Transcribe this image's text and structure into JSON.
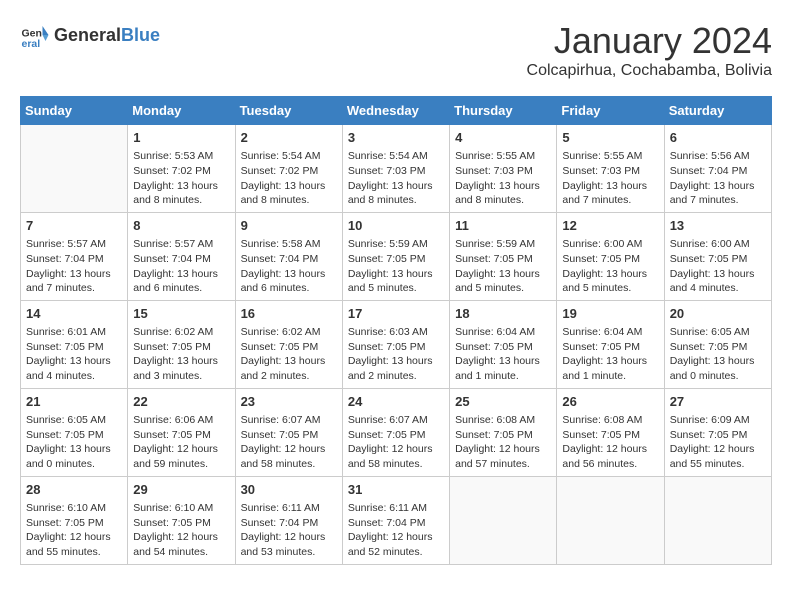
{
  "logo": {
    "general": "General",
    "blue": "Blue"
  },
  "title": "January 2024",
  "subtitle": "Colcapirhua, Cochabamba, Bolivia",
  "days_of_week": [
    "Sunday",
    "Monday",
    "Tuesday",
    "Wednesday",
    "Thursday",
    "Friday",
    "Saturday"
  ],
  "weeks": [
    [
      {
        "day": "",
        "info": ""
      },
      {
        "day": "1",
        "info": "Sunrise: 5:53 AM\nSunset: 7:02 PM\nDaylight: 13 hours\nand 8 minutes."
      },
      {
        "day": "2",
        "info": "Sunrise: 5:54 AM\nSunset: 7:02 PM\nDaylight: 13 hours\nand 8 minutes."
      },
      {
        "day": "3",
        "info": "Sunrise: 5:54 AM\nSunset: 7:03 PM\nDaylight: 13 hours\nand 8 minutes."
      },
      {
        "day": "4",
        "info": "Sunrise: 5:55 AM\nSunset: 7:03 PM\nDaylight: 13 hours\nand 8 minutes."
      },
      {
        "day": "5",
        "info": "Sunrise: 5:55 AM\nSunset: 7:03 PM\nDaylight: 13 hours\nand 7 minutes."
      },
      {
        "day": "6",
        "info": "Sunrise: 5:56 AM\nSunset: 7:04 PM\nDaylight: 13 hours\nand 7 minutes."
      }
    ],
    [
      {
        "day": "7",
        "info": "Sunrise: 5:57 AM\nSunset: 7:04 PM\nDaylight: 13 hours\nand 7 minutes."
      },
      {
        "day": "8",
        "info": "Sunrise: 5:57 AM\nSunset: 7:04 PM\nDaylight: 13 hours\nand 6 minutes."
      },
      {
        "day": "9",
        "info": "Sunrise: 5:58 AM\nSunset: 7:04 PM\nDaylight: 13 hours\nand 6 minutes."
      },
      {
        "day": "10",
        "info": "Sunrise: 5:59 AM\nSunset: 7:05 PM\nDaylight: 13 hours\nand 5 minutes."
      },
      {
        "day": "11",
        "info": "Sunrise: 5:59 AM\nSunset: 7:05 PM\nDaylight: 13 hours\nand 5 minutes."
      },
      {
        "day": "12",
        "info": "Sunrise: 6:00 AM\nSunset: 7:05 PM\nDaylight: 13 hours\nand 5 minutes."
      },
      {
        "day": "13",
        "info": "Sunrise: 6:00 AM\nSunset: 7:05 PM\nDaylight: 13 hours\nand 4 minutes."
      }
    ],
    [
      {
        "day": "14",
        "info": "Sunrise: 6:01 AM\nSunset: 7:05 PM\nDaylight: 13 hours\nand 4 minutes."
      },
      {
        "day": "15",
        "info": "Sunrise: 6:02 AM\nSunset: 7:05 PM\nDaylight: 13 hours\nand 3 minutes."
      },
      {
        "day": "16",
        "info": "Sunrise: 6:02 AM\nSunset: 7:05 PM\nDaylight: 13 hours\nand 2 minutes."
      },
      {
        "day": "17",
        "info": "Sunrise: 6:03 AM\nSunset: 7:05 PM\nDaylight: 13 hours\nand 2 minutes."
      },
      {
        "day": "18",
        "info": "Sunrise: 6:04 AM\nSunset: 7:05 PM\nDaylight: 13 hours\nand 1 minute."
      },
      {
        "day": "19",
        "info": "Sunrise: 6:04 AM\nSunset: 7:05 PM\nDaylight: 13 hours\nand 1 minute."
      },
      {
        "day": "20",
        "info": "Sunrise: 6:05 AM\nSunset: 7:05 PM\nDaylight: 13 hours\nand 0 minutes."
      }
    ],
    [
      {
        "day": "21",
        "info": "Sunrise: 6:05 AM\nSunset: 7:05 PM\nDaylight: 13 hours\nand 0 minutes."
      },
      {
        "day": "22",
        "info": "Sunrise: 6:06 AM\nSunset: 7:05 PM\nDaylight: 12 hours\nand 59 minutes."
      },
      {
        "day": "23",
        "info": "Sunrise: 6:07 AM\nSunset: 7:05 PM\nDaylight: 12 hours\nand 58 minutes."
      },
      {
        "day": "24",
        "info": "Sunrise: 6:07 AM\nSunset: 7:05 PM\nDaylight: 12 hours\nand 58 minutes."
      },
      {
        "day": "25",
        "info": "Sunrise: 6:08 AM\nSunset: 7:05 PM\nDaylight: 12 hours\nand 57 minutes."
      },
      {
        "day": "26",
        "info": "Sunrise: 6:08 AM\nSunset: 7:05 PM\nDaylight: 12 hours\nand 56 minutes."
      },
      {
        "day": "27",
        "info": "Sunrise: 6:09 AM\nSunset: 7:05 PM\nDaylight: 12 hours\nand 55 minutes."
      }
    ],
    [
      {
        "day": "28",
        "info": "Sunrise: 6:10 AM\nSunset: 7:05 PM\nDaylight: 12 hours\nand 55 minutes."
      },
      {
        "day": "29",
        "info": "Sunrise: 6:10 AM\nSunset: 7:05 PM\nDaylight: 12 hours\nand 54 minutes."
      },
      {
        "day": "30",
        "info": "Sunrise: 6:11 AM\nSunset: 7:04 PM\nDaylight: 12 hours\nand 53 minutes."
      },
      {
        "day": "31",
        "info": "Sunrise: 6:11 AM\nSunset: 7:04 PM\nDaylight: 12 hours\nand 52 minutes."
      },
      {
        "day": "",
        "info": ""
      },
      {
        "day": "",
        "info": ""
      },
      {
        "day": "",
        "info": ""
      }
    ]
  ]
}
